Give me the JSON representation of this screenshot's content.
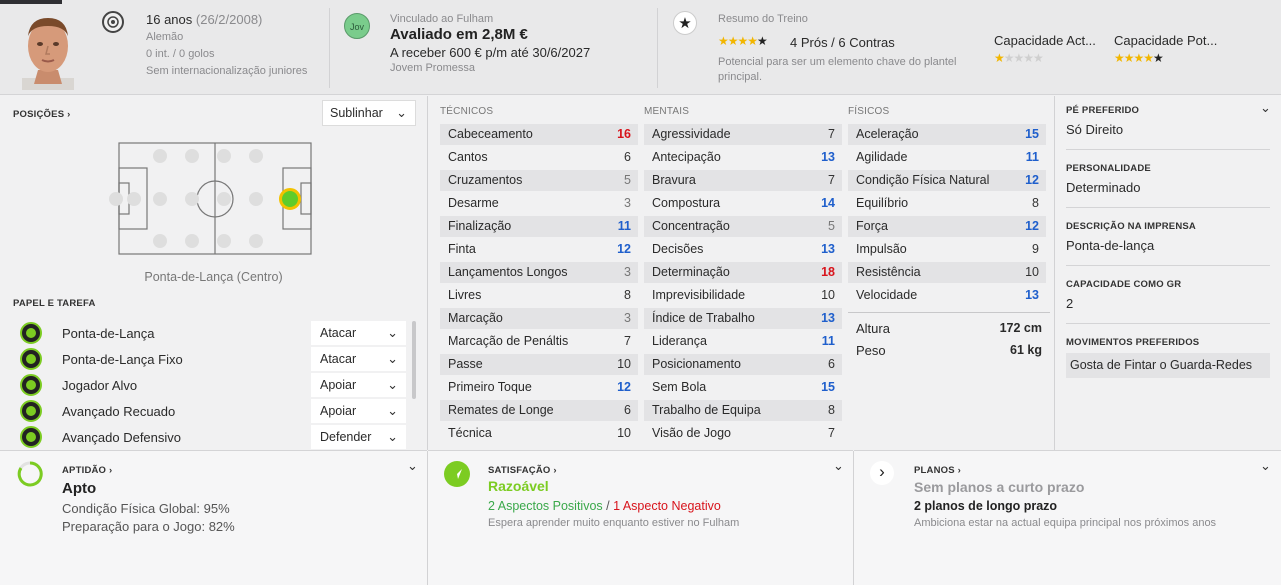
{
  "header": {
    "age": "16 anos",
    "dob": "(26/2/2008)",
    "nationality": "Alemão",
    "caps": "0 int. / 0 golos",
    "youth_caps": "Sem internacionalização juniores",
    "club_line": "Vinculado ao Fulham",
    "value": "Avaliado em 2,8M €",
    "wage": "A receber 600 € p/m até 30/6/2027",
    "status": "Jovem Promessa",
    "badge_label": "Jov",
    "training_title": "Resumo do Treino",
    "training_stars": 4,
    "pros_cons": "4 Prós / 6 Contras",
    "training_desc": "Potencial para ser um elemento chave do plantel principal.",
    "ca_label": "Capacidade Act...",
    "pa_label": "Capacidade Pot...",
    "ca_stars": 0.5,
    "pa_stars": 4
  },
  "positions": {
    "title": "POSIÇÕES",
    "dropdown": "Sublinhar",
    "position_label": "Ponta-de-Lança (Centro)"
  },
  "roles": {
    "title": "PAPEL E TAREFA",
    "items": [
      {
        "name": "Ponta-de-Lança",
        "duty": "Atacar"
      },
      {
        "name": "Ponta-de-Lança Fixo",
        "duty": "Atacar"
      },
      {
        "name": "Jogador Alvo",
        "duty": "Apoiar"
      },
      {
        "name": "Avançado Recuado",
        "duty": "Apoiar"
      },
      {
        "name": "Avançado Defensivo",
        "duty": "Defender"
      }
    ]
  },
  "attributes": {
    "technical_title": "TÉCNICOS",
    "mental_title": "MENTAIS",
    "physical_title": "FÍSICOS",
    "technical": [
      {
        "name": "Cabeceamento",
        "value": "16",
        "tone": "red"
      },
      {
        "name": "Cantos",
        "value": "6",
        "tone": "dark"
      },
      {
        "name": "Cruzamentos",
        "value": "5",
        "tone": "grey"
      },
      {
        "name": "Desarme",
        "value": "3",
        "tone": "grey"
      },
      {
        "name": "Finalização",
        "value": "11",
        "tone": "blue"
      },
      {
        "name": "Finta",
        "value": "12",
        "tone": "blue"
      },
      {
        "name": "Lançamentos Longos",
        "value": "3",
        "tone": "grey"
      },
      {
        "name": "Livres",
        "value": "8",
        "tone": "dark"
      },
      {
        "name": "Marcação",
        "value": "3",
        "tone": "grey"
      },
      {
        "name": "Marcação de Penáltis",
        "value": "7",
        "tone": "dark"
      },
      {
        "name": "Passe",
        "value": "10",
        "tone": "dark"
      },
      {
        "name": "Primeiro Toque",
        "value": "12",
        "tone": "blue"
      },
      {
        "name": "Remates de Longe",
        "value": "6",
        "tone": "dark"
      },
      {
        "name": "Técnica",
        "value": "10",
        "tone": "dark"
      }
    ],
    "mental": [
      {
        "name": "Agressividade",
        "value": "7",
        "tone": "dark"
      },
      {
        "name": "Antecipação",
        "value": "13",
        "tone": "blue"
      },
      {
        "name": "Bravura",
        "value": "7",
        "tone": "dark"
      },
      {
        "name": "Compostura",
        "value": "14",
        "tone": "blue"
      },
      {
        "name": "Concentração",
        "value": "5",
        "tone": "grey"
      },
      {
        "name": "Decisões",
        "value": "13",
        "tone": "blue"
      },
      {
        "name": "Determinação",
        "value": "18",
        "tone": "red"
      },
      {
        "name": "Imprevisibilidade",
        "value": "10",
        "tone": "dark"
      },
      {
        "name": "Índice de Trabalho",
        "value": "13",
        "tone": "blue"
      },
      {
        "name": "Liderança",
        "value": "11",
        "tone": "blue"
      },
      {
        "name": "Posicionamento",
        "value": "6",
        "tone": "dark"
      },
      {
        "name": "Sem Bola",
        "value": "15",
        "tone": "blue"
      },
      {
        "name": "Trabalho de Equipa",
        "value": "8",
        "tone": "dark"
      },
      {
        "name": "Visão de Jogo",
        "value": "7",
        "tone": "dark"
      }
    ],
    "physical": [
      {
        "name": "Aceleração",
        "value": "15",
        "tone": "blue"
      },
      {
        "name": "Agilidade",
        "value": "11",
        "tone": "blue"
      },
      {
        "name": "Condição Física Natural",
        "value": "12",
        "tone": "blue"
      },
      {
        "name": "Equilíbrio",
        "value": "8",
        "tone": "dark"
      },
      {
        "name": "Força",
        "value": "12",
        "tone": "blue"
      },
      {
        "name": "Impulsão",
        "value": "9",
        "tone": "dark"
      },
      {
        "name": "Resistência",
        "value": "10",
        "tone": "dark"
      },
      {
        "name": "Velocidade",
        "value": "13",
        "tone": "blue"
      }
    ],
    "height_label": "Altura",
    "height_value": "172 cm",
    "weight_label": "Peso",
    "weight_value": "61 kg"
  },
  "info": {
    "foot_title": "PÉ PREFERIDO",
    "foot_value": "Só Direito",
    "personality_title": "PERSONALIDADE",
    "personality_value": "Determinado",
    "press_title": "DESCRIÇÃO NA IMPRENSA",
    "press_value": "Ponta-de-lança",
    "gk_title": "CAPACIDADE COMO GR",
    "gk_value": "2",
    "moves_title": "MOVIMENTOS PREFERIDOS",
    "moves_value": "Gosta de Fintar o Guarda-Redes"
  },
  "fitness": {
    "title": "APTIDÃO",
    "status": "Apto",
    "overall": "Condição Física Global: 95%",
    "match": "Preparação para o Jogo: 82%"
  },
  "satisfaction": {
    "title": "SATISFAÇÃO",
    "status": "Razoável",
    "positive": "2 Aspectos Positivos",
    "divider": "/",
    "negative": "1 Aspecto Negativo",
    "note": "Espera aprender muito enquanto estiver no Fulham"
  },
  "plans": {
    "title": "PLANOS",
    "short": "Sem planos a curto prazo",
    "long": "2 planos de longo prazo",
    "note": "Ambiciona estar na actual equipa principal nos próximos anos"
  },
  "colors": {
    "red": "#d8141c",
    "blue": "#1f5fcc",
    "green": "#7ccc22",
    "star": "#f2b600"
  }
}
